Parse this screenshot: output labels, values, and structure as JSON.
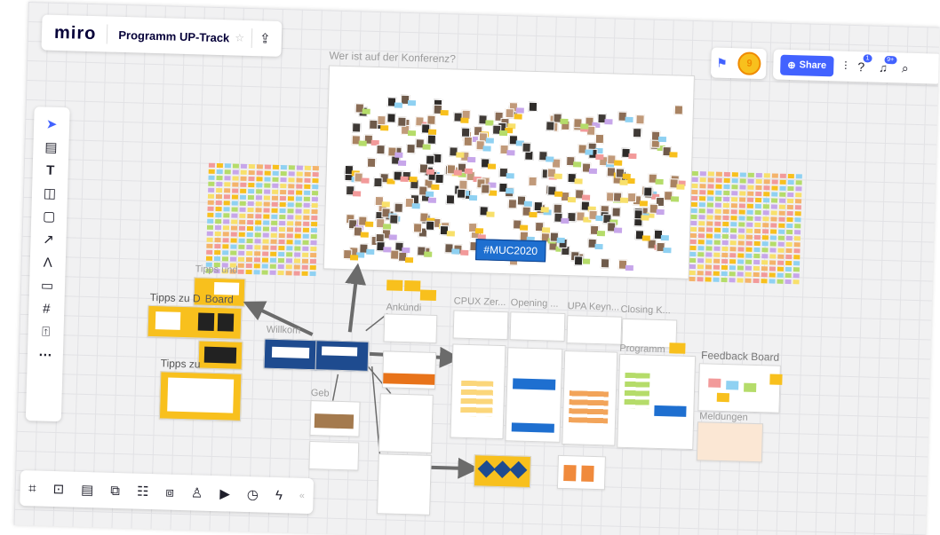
{
  "app": {
    "logo": "miro",
    "board_title": "Programm UP-Track"
  },
  "toolbar": {
    "share_label": "Share",
    "help_badge": "1",
    "notif_badge": "9+",
    "user_initial": "9"
  },
  "colors": {
    "accent": "#4262ff",
    "sticky_yellow": "#f8c01d",
    "navy": "#1e4b8f"
  },
  "frames": {
    "conference": "Wer ist auf der Konferenz?",
    "hashtag": "#MUC2020",
    "tipps_top": "Tipps und",
    "tipps_board": "Tipps zu D",
    "board_word": "Board",
    "tipps_zu": "Tipps zu",
    "willkommen": "Willkom",
    "geb": "Geb",
    "cpux": "CPUX Zer...",
    "opening": "Opening ...",
    "upa": "UPA Keyn...",
    "closing": "Closing K...",
    "programm": "Programm",
    "feedback": "Feedback Board",
    "meldungen": "Meldungen",
    "ank": "Ankündi"
  }
}
